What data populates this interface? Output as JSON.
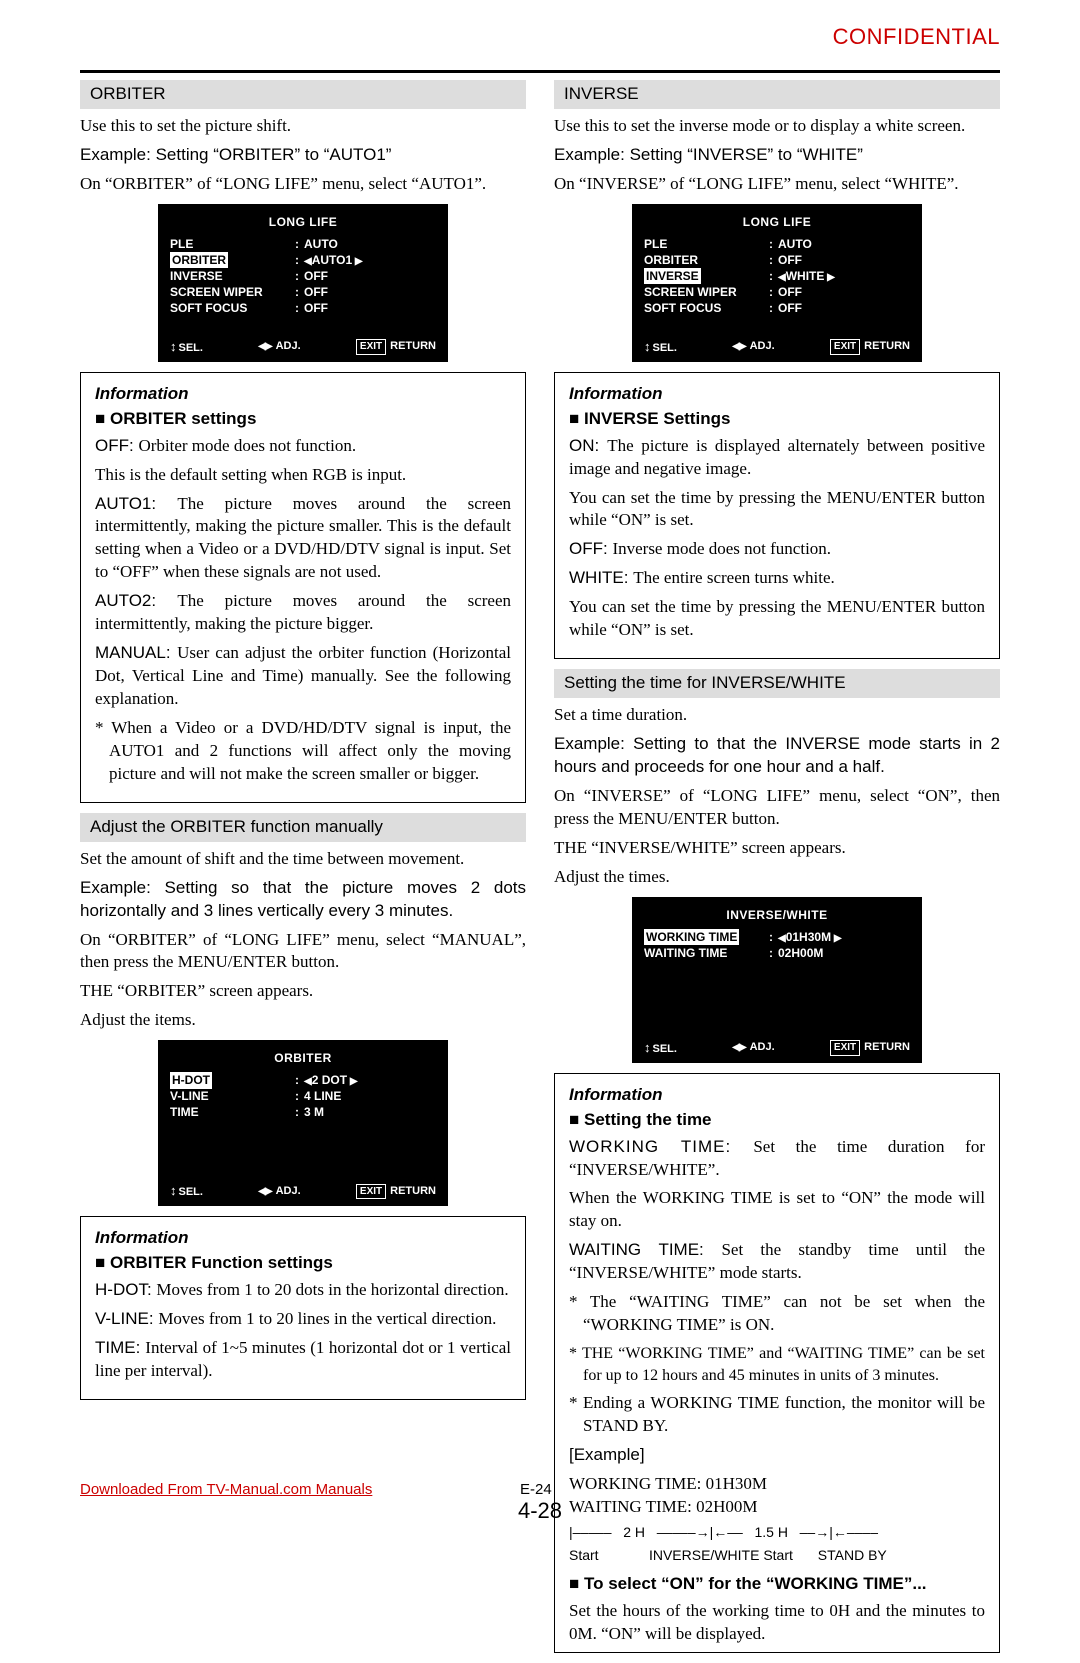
{
  "header": {
    "confidential": "CONFIDENTIAL"
  },
  "pageNumbers": {
    "e": "E-24",
    "chap": "4-28"
  },
  "footerLink": "Downloaded From TV-Manual.com Manuals",
  "left": {
    "orbiter": {
      "head": "ORBITER",
      "intro": "Use this to set the picture shift.",
      "example": "Example: Setting “ORBITER” to “AUTO1”",
      "step": "On “ORBITER” of “LONG LIFE” menu, select “AUTO1”.",
      "osd": {
        "title": "LONG LIFE",
        "rows": [
          {
            "label": "PLE",
            "value": "AUTO",
            "hi": false,
            "arrows": false
          },
          {
            "label": "ORBITER",
            "value": "AUTO1",
            "hi": true,
            "arrows": true
          },
          {
            "label": "INVERSE",
            "value": "OFF",
            "hi": false,
            "arrows": false
          },
          {
            "label": "SCREEN WIPER",
            "value": "OFF",
            "hi": false,
            "arrows": false
          },
          {
            "label": "SOFT FOCUS",
            "value": "OFF",
            "hi": false,
            "arrows": false
          }
        ],
        "footer": {
          "sel": "SEL.",
          "adj": "ADJ.",
          "exit": "EXIT",
          "ret": "RETURN"
        }
      },
      "info": {
        "title": "Information",
        "sub": "ORBITER settings",
        "off": "OFF: ",
        "offText": "Orbiter mode does not function.",
        "defaultRgb": "This is the default setting when RGB is input.",
        "auto1": "AUTO1: ",
        "auto1Text": "The picture moves around the screen intermittently, making the picture smaller. This is the default setting when a Video or a DVD/HD/DTV signal is input. Set to “OFF” when these signals are not used.",
        "auto2": "AUTO2: ",
        "auto2Text": "The picture moves around the screen intermittently, making the picture bigger.",
        "manual": "MANUAL: ",
        "manualText": "User can adjust the orbiter function (Horizontal Dot, Vertical Line and Time) manually. See the following explanation.",
        "note": "* When a Video or a DVD/HD/DTV signal is input, the AUTO1 and 2 functions will affect only the moving picture and will not make the screen smaller or bigger."
      },
      "manual": {
        "head": "Adjust the ORBITER function manually",
        "p1": "Set the amount of shift and the time between movement.",
        "p2": "Example: Setting so that the picture moves 2 dots horizontally and 3 lines vertically every 3 minutes.",
        "p3": "On “ORBITER” of “LONG LIFE” menu, select “MANUAL”, then press the MENU/ENTER button.",
        "p4": "THE “ORBITER” screen appears.",
        "p5": "Adjust the items.",
        "osd": {
          "title": "ORBITER",
          "rows": [
            {
              "label": "H-DOT",
              "value": "2 DOT",
              "hi": true,
              "arrows": true
            },
            {
              "label": "V-LINE",
              "value": "4 LINE",
              "hi": false,
              "arrows": false
            },
            {
              "label": "TIME",
              "value": "3 M",
              "hi": false,
              "arrows": false
            }
          ]
        },
        "info": {
          "title": "Information",
          "sub": "ORBITER Function settings",
          "hdot": "H-DOT: ",
          "hdotText": "Moves from 1 to 20 dots in the horizontal direction.",
          "vline": "V-LINE: ",
          "vlineText": "Moves from 1 to 20 lines in the vertical direction.",
          "time": "TIME: ",
          "timeText": "Interval of 1~5 minutes (1 horizontal dot or 1 vertical line per interval)."
        }
      }
    }
  },
  "right": {
    "inverse": {
      "head": "INVERSE",
      "intro": "Use this to set the inverse mode or to display a white screen.",
      "example": "Example: Setting “INVERSE” to “WHITE”",
      "step": "On “INVERSE” of “LONG LIFE” menu, select “WHITE”.",
      "osd": {
        "title": "LONG LIFE",
        "rows": [
          {
            "label": "PLE",
            "value": "AUTO",
            "hi": false,
            "arrows": false
          },
          {
            "label": "ORBITER",
            "value": "OFF",
            "hi": false,
            "arrows": false
          },
          {
            "label": "INVERSE",
            "value": "WHITE",
            "hi": true,
            "arrows": true
          },
          {
            "label": "SCREEN WIPER",
            "value": "OFF",
            "hi": false,
            "arrows": false
          },
          {
            "label": "SOFT FOCUS",
            "value": "OFF",
            "hi": false,
            "arrows": false
          }
        ]
      },
      "info": {
        "title": "Information",
        "sub": "INVERSE Settings",
        "on": "ON: ",
        "onText": "The picture is displayed alternately between positive image and negative image.",
        "onNote": "You can set the time by pressing the MENU/ENTER button while “ON” is set.",
        "off": "OFF: ",
        "offText": "Inverse mode does not function.",
        "white": "WHITE: ",
        "whiteText": "The entire screen turns white.",
        "whiteNote": "You can set the time by pressing the MENU/ENTER button while “ON” is set."
      },
      "timing": {
        "head": "Setting the time for INVERSE/WHITE",
        "p1": "Set a time duration.",
        "p2": "Example: Setting to that the INVERSE mode starts in 2 hours and proceeds for one hour and a half.",
        "p3": "On “INVERSE” of “LONG LIFE” menu, select “ON”, then press the MENU/ENTER button.",
        "p4": "THE “INVERSE/WHITE” screen appears.",
        "p5": "Adjust the times.",
        "osd": {
          "title": "INVERSE/WHITE",
          "rows": [
            {
              "label": "WORKING TIME",
              "value": "01H30M",
              "hi": true,
              "arrows": true
            },
            {
              "label": "WAITING TIME",
              "value": "02H00M",
              "hi": false,
              "arrows": false
            }
          ]
        },
        "info": {
          "title": "Information",
          "sub": "Setting the time",
          "work": "WORKING TIME: ",
          "workText": "Set the time duration for “INVERSE/WHITE”.",
          "workOn": "When the WORKING TIME is set to “ON” the mode will stay on.",
          "wait": "WAITING TIME: ",
          "waitText": "Set the standby time until the “INVERSE/WHITE” mode starts.",
          "n1": "* The “WAITING TIME” can not be set when the “WORKING TIME” is ON.",
          "n2": "* THE “WORKING TIME” and “WAITING TIME” can be set for up to 12 hours and 45 minutes in units of 3 minutes.",
          "n3": "* Ending a WORKING TIME function, the monitor will be STAND BY.",
          "exTitle": "[Example]",
          "ex1": "WORKING TIME: 01H30M",
          "ex2": "WAITING TIME:   02H00M",
          "tl1": "|–––––   2 H   –––––→|←––   1.5 H   ––→|←––––",
          "tl2": "Start",
          "tl3": "INVERSE/WHITE Start",
          "tl4": "STAND BY",
          "toOnTitle": "To select “ON” for the “WORKING TIME”...",
          "toOnText": "Set the hours of the working time to 0H and the minutes to 0M. “ON” will be displayed."
        }
      }
    }
  }
}
